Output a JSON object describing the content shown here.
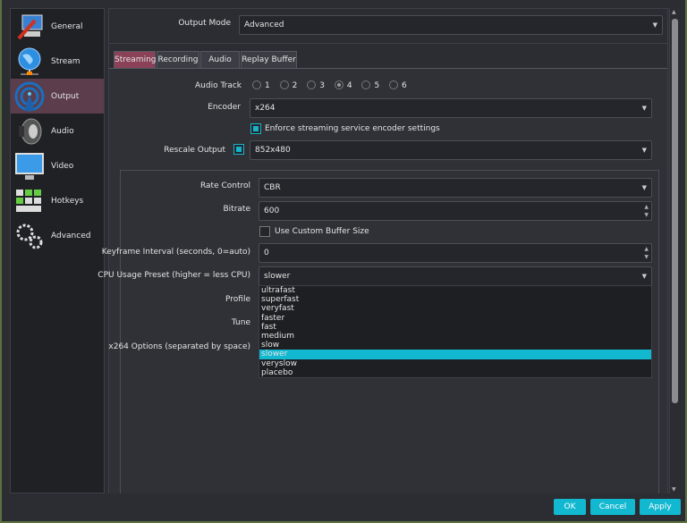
{
  "sidebar": {
    "items": [
      {
        "label": "General",
        "icon": "general-icon"
      },
      {
        "label": "Stream",
        "icon": "globe-icon"
      },
      {
        "label": "Output",
        "icon": "broadcast-icon",
        "selected": true
      },
      {
        "label": "Audio",
        "icon": "speaker-icon"
      },
      {
        "label": "Video",
        "icon": "monitor-icon"
      },
      {
        "label": "Hotkeys",
        "icon": "keyboard-icon"
      },
      {
        "label": "Advanced",
        "icon": "gears-icon"
      }
    ]
  },
  "output_mode": {
    "label": "Output Mode",
    "value": "Advanced"
  },
  "tabs": [
    "Streaming",
    "Recording",
    "Audio",
    "Replay Buffer"
  ],
  "streaming": {
    "audio_track_label": "Audio Track",
    "audio_tracks": [
      "1",
      "2",
      "3",
      "4",
      "5",
      "6"
    ],
    "audio_track_selected": "4",
    "encoder_label": "Encoder",
    "encoder": "x264",
    "enforce_label": "Enforce streaming service encoder settings",
    "enforce_checked": true,
    "rescale_label": "Rescale Output",
    "rescale_checked": true,
    "rescale_value": "852x480",
    "rate_control_label": "Rate Control",
    "rate_control": "CBR",
    "bitrate_label": "Bitrate",
    "bitrate": "600",
    "custom_buffer_label": "Use Custom Buffer Size",
    "custom_buffer_checked": false,
    "keyframe_label": "Keyframe Interval (seconds, 0=auto)",
    "keyframe": "0",
    "preset_label": "CPU Usage Preset (higher = less CPU)",
    "preset": "slower",
    "preset_options": [
      "ultrafast",
      "superfast",
      "veryfast",
      "faster",
      "fast",
      "medium",
      "slow",
      "slower",
      "veryslow",
      "placebo"
    ],
    "profile_label": "Profile",
    "tune_label": "Tune",
    "x264_options_label": "x264 Options (separated by space)"
  },
  "buttons": {
    "ok": "OK",
    "cancel": "Cancel",
    "apply": "Apply"
  },
  "colors": {
    "accent": "#11b8d0",
    "selected_tab": "#8b4258",
    "selected_sidebar": "#5b3d4b"
  }
}
